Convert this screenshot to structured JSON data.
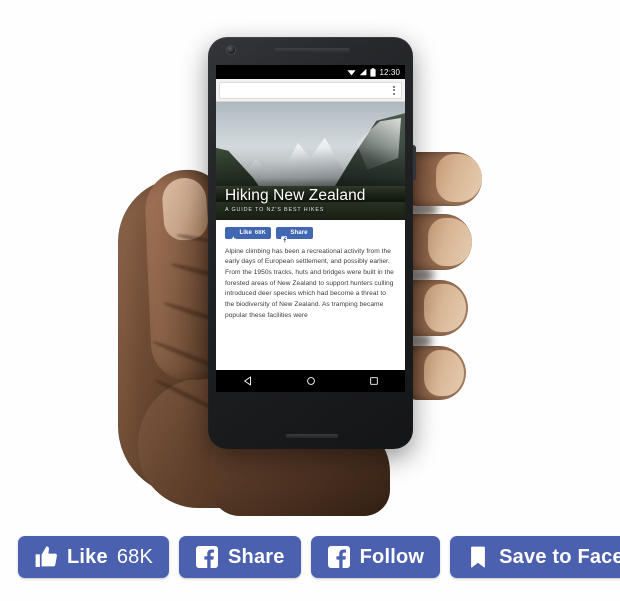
{
  "scene": {
    "name": "facebook-social-plugin-promo",
    "background_color": "#fefefe"
  },
  "phone": {
    "status_bar": {
      "clock": "12:30",
      "icons": [
        "wifi-icon",
        "signal-icon",
        "battery-icon"
      ],
      "background_color": "#000000"
    },
    "browser": {
      "omnibox_value": "",
      "omnibox_placeholder": "",
      "overflow_menu_label": "More options"
    },
    "article": {
      "title": "Hiking New Zealand",
      "kicker": "A GUIDE TO NZ'S BEST HIKES",
      "paragraph": "Alpine climbing has been a recreational activity from the early days of European settlement, and possibly earlier. From the 1950s tracks, huts and bridges were built in the forested areas of New Zealand to support hunters culling introduced deer species which had become a threat to the biodiversity of New Zealand. As tramping became popular these facilities were",
      "inline_buttons": [
        {
          "icon": "thumbs-up-icon",
          "label": "Like",
          "count": "68K"
        },
        {
          "icon": "facebook-f-icon",
          "label": "Share",
          "count": ""
        }
      ]
    },
    "nav_bar": {
      "items": [
        {
          "icon": "back-triangle-icon",
          "label": "Back"
        },
        {
          "icon": "home-circle-icon",
          "label": "Home"
        },
        {
          "icon": "recents-square-icon",
          "label": "Recents"
        }
      ]
    }
  },
  "button_row": {
    "accent_color": "#4b61b0",
    "buttons": [
      {
        "icon": "thumbs-up-icon",
        "label": "Like",
        "count": "68K"
      },
      {
        "icon": "facebook-f-icon",
        "label": "Share",
        "count": ""
      },
      {
        "icon": "facebook-f-icon",
        "label": "Follow",
        "count": ""
      },
      {
        "icon": "bookmark-icon",
        "label": "Save to Facebook",
        "count": ""
      }
    ]
  }
}
